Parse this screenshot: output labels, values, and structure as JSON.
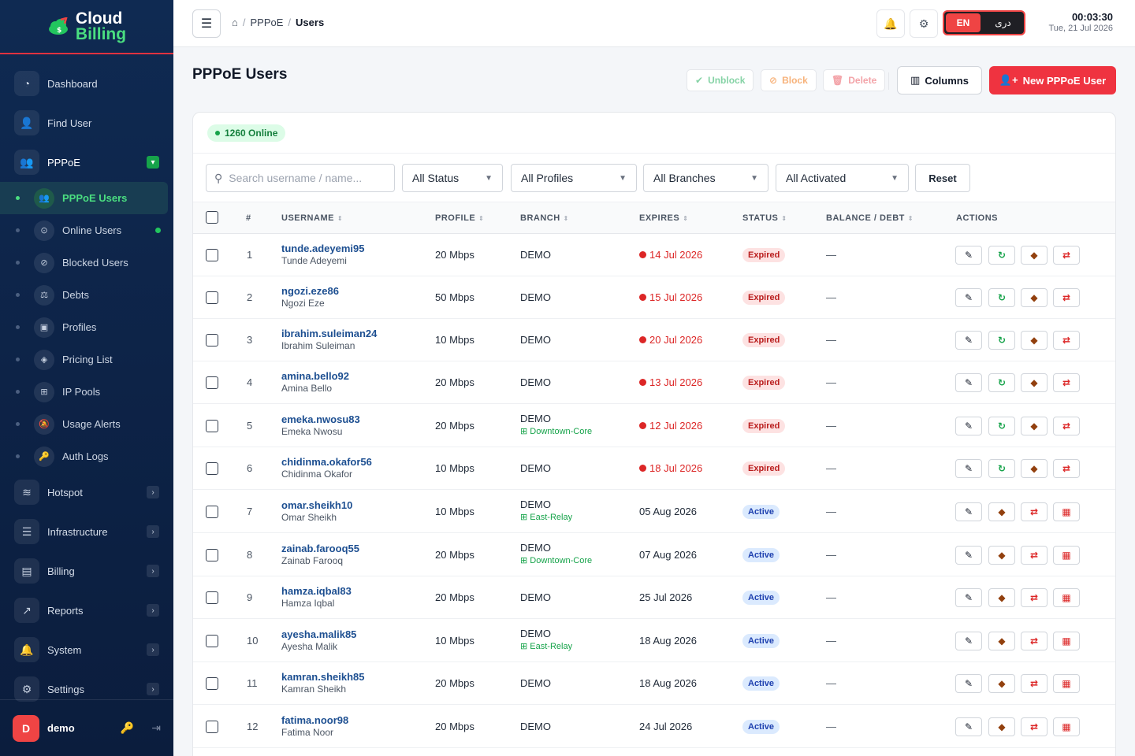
{
  "brand": {
    "line1": "Cloud",
    "line2": "Billing"
  },
  "sidebar": {
    "top_items": [
      {
        "label": "Dashboard",
        "icon": "dashboard-icon"
      },
      {
        "label": "Find User",
        "icon": "find-user-icon"
      },
      {
        "label": "PPPoE",
        "icon": "pppoe-icon"
      }
    ],
    "pppoe_children": [
      {
        "label": "PPPoE Users",
        "icon": "users-icon"
      },
      {
        "label": "Online Users",
        "icon": "online-icon"
      },
      {
        "label": "Blocked Users",
        "icon": "blocked-icon"
      },
      {
        "label": "Debts",
        "icon": "debts-icon"
      },
      {
        "label": "Profiles",
        "icon": "profiles-icon"
      },
      {
        "label": "Pricing List",
        "icon": "pricing-icon"
      },
      {
        "label": "IP Pools",
        "icon": "ip-pools-icon"
      },
      {
        "label": "Usage Alerts",
        "icon": "usage-alerts-icon"
      },
      {
        "label": "Auth Logs",
        "icon": "auth-logs-icon"
      }
    ],
    "bottom_items": [
      {
        "label": "Hotspot",
        "icon": "wifi-icon"
      },
      {
        "label": "Infrastructure",
        "icon": "server-icon"
      },
      {
        "label": "Billing",
        "icon": "billing-icon"
      },
      {
        "label": "Reports",
        "icon": "chart-icon"
      },
      {
        "label": "System",
        "icon": "bell-icon"
      },
      {
        "label": "Settings",
        "icon": "gear-icon"
      }
    ],
    "user": {
      "initial": "D",
      "name": "demo"
    }
  },
  "topbar": {
    "breadcrumb": [
      "PPPoE",
      "Users"
    ],
    "lang_en": "EN",
    "lang_fa": "دری",
    "time": "00:03:30",
    "date": "Tue, 21 Jul 2026"
  },
  "page": {
    "title": "PPPoE Users",
    "unblock": "Unblock",
    "block": "Block",
    "delete": "Delete",
    "columns": "Columns",
    "new_user": "New PPPoE User"
  },
  "filters": {
    "online_count": "1260 Online",
    "search_placeholder": "Search username / name...",
    "status": "All Status",
    "profiles": "All Profiles",
    "branches": "All Branches",
    "activated": "All Activated",
    "reset": "Reset"
  },
  "table": {
    "headers": {
      "num": "#",
      "username": "USERNAME",
      "profile": "PROFILE",
      "branch": "BRANCH",
      "expires": "EXPIRES",
      "status": "STATUS",
      "balance": "BALANCE / DEBT",
      "actions": "ACTIONS"
    },
    "rows": [
      {
        "n": "1",
        "username": "tunde.adeyemi95",
        "name": "Tunde Adeyemi",
        "profile": "20 Mbps",
        "branch": "DEMO",
        "sub_branch": "",
        "expires": "14 Jul 2026",
        "expired": true,
        "status": "Expired",
        "balance": "—"
      },
      {
        "n": "2",
        "username": "ngozi.eze86",
        "name": "Ngozi Eze",
        "profile": "50 Mbps",
        "branch": "DEMO",
        "sub_branch": "",
        "expires": "15 Jul 2026",
        "expired": true,
        "status": "Expired",
        "balance": "—"
      },
      {
        "n": "3",
        "username": "ibrahim.suleiman24",
        "name": "Ibrahim Suleiman",
        "profile": "10 Mbps",
        "branch": "DEMO",
        "sub_branch": "",
        "expires": "20 Jul 2026",
        "expired": true,
        "status": "Expired",
        "balance": "—"
      },
      {
        "n": "4",
        "username": "amina.bello92",
        "name": "Amina Bello",
        "profile": "20 Mbps",
        "branch": "DEMO",
        "sub_branch": "",
        "expires": "13 Jul 2026",
        "expired": true,
        "status": "Expired",
        "balance": "—"
      },
      {
        "n": "5",
        "username": "emeka.nwosu83",
        "name": "Emeka Nwosu",
        "profile": "20 Mbps",
        "branch": "DEMO",
        "sub_branch": "Downtown-Core",
        "expires": "12 Jul 2026",
        "expired": true,
        "status": "Expired",
        "balance": "—"
      },
      {
        "n": "6",
        "username": "chidinma.okafor56",
        "name": "Chidinma Okafor",
        "profile": "10 Mbps",
        "branch": "DEMO",
        "sub_branch": "",
        "expires": "18 Jul 2026",
        "expired": true,
        "status": "Expired",
        "balance": "—"
      },
      {
        "n": "7",
        "username": "omar.sheikh10",
        "name": "Omar Sheikh",
        "profile": "10 Mbps",
        "branch": "DEMO",
        "sub_branch": "East-Relay",
        "expires": "05 Aug 2026",
        "expired": false,
        "status": "Active",
        "balance": "—"
      },
      {
        "n": "8",
        "username": "zainab.farooq55",
        "name": "Zainab Farooq",
        "profile": "20 Mbps",
        "branch": "DEMO",
        "sub_branch": "Downtown-Core",
        "expires": "07 Aug 2026",
        "expired": false,
        "status": "Active",
        "balance": "—"
      },
      {
        "n": "9",
        "username": "hamza.iqbal83",
        "name": "Hamza Iqbal",
        "profile": "20 Mbps",
        "branch": "DEMO",
        "sub_branch": "",
        "expires": "25 Jul 2026",
        "expired": false,
        "status": "Active",
        "balance": "—"
      },
      {
        "n": "10",
        "username": "ayesha.malik85",
        "name": "Ayesha Malik",
        "profile": "10 Mbps",
        "branch": "DEMO",
        "sub_branch": "East-Relay",
        "expires": "18 Aug 2026",
        "expired": false,
        "status": "Active",
        "balance": "—"
      },
      {
        "n": "11",
        "username": "kamran.sheikh85",
        "name": "Kamran Sheikh",
        "profile": "20 Mbps",
        "branch": "DEMO",
        "sub_branch": "",
        "expires": "18 Aug 2026",
        "expired": false,
        "status": "Active",
        "balance": "—"
      },
      {
        "n": "12",
        "username": "fatima.noor98",
        "name": "Fatima Noor",
        "profile": "20 Mbps",
        "branch": "DEMO",
        "sub_branch": "",
        "expires": "24 Jul 2026",
        "expired": false,
        "status": "Active",
        "balance": "—"
      }
    ]
  }
}
